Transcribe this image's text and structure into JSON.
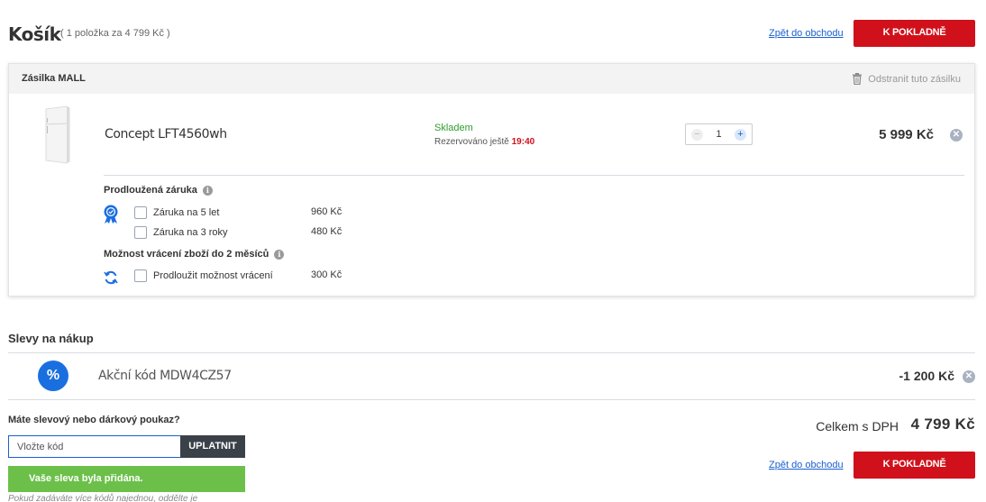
{
  "header": {
    "title": "Košík",
    "subtitle": "( 1 položka za 4 799 Kč )",
    "back_link": "Zpět do obchodu",
    "checkout_button": "K POKLADNĚ"
  },
  "shipment": {
    "title": "Zásilka MALL",
    "remove_label": "Odstranit tuto zásilku",
    "product": {
      "name": "Concept LFT4560wh",
      "stock": "Skladem",
      "reserved_prefix": "Rezervováno ještě",
      "reserved_time": "19:40",
      "quantity": "1",
      "price": "5 999 Kč"
    },
    "warranty": {
      "title": "Prodloužená záruka",
      "options": [
        {
          "label": "Záruka na 5 let",
          "price": "960 Kč"
        },
        {
          "label": "Záruka na 3 roky",
          "price": "480 Kč"
        }
      ]
    },
    "returns": {
      "title": "Možnost vrácení zboží do 2 měsíců",
      "option": {
        "label": "Prodloužit možnost vrácení",
        "price": "300 Kč"
      }
    }
  },
  "discounts": {
    "title": "Slevy na nákup",
    "badge": "%",
    "code_label": "Akční kód MDW4CZ57",
    "value": "-1 200 Kč"
  },
  "voucher": {
    "question": "Máte slevový nebo dárkový poukaz?",
    "placeholder": "Vložte kód",
    "apply_button": "UPLATNIT",
    "success": "Vaše sleva byla přidána.",
    "hint": "Pokud zadáváte více kódů najednou, oddělte je"
  },
  "summary": {
    "total_label": "Celkem s DPH",
    "total_value": "4 799 Kč",
    "back_link": "Zpět do obchodu",
    "checkout_button": "K POKLADNĚ"
  },
  "colors": {
    "accent_red": "#d0111b",
    "link_blue": "#1a5fd0",
    "success_green": "#6cc04a",
    "stock_green": "#2e9c2e"
  }
}
